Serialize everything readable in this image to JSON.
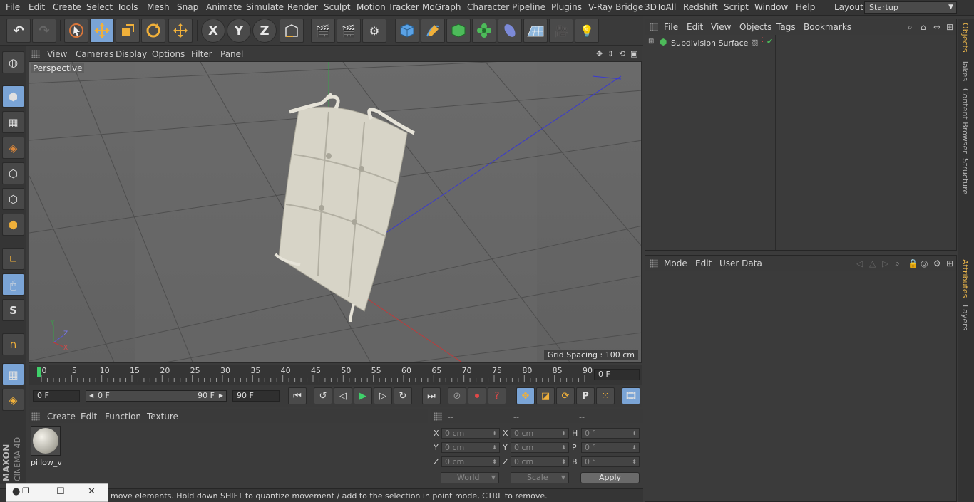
{
  "menubar": {
    "items": [
      "File",
      "Edit",
      "Create",
      "Select",
      "Tools",
      "Mesh",
      "Snap",
      "Animate",
      "Simulate",
      "Render",
      "Sculpt",
      "Motion Tracker",
      "MoGraph",
      "Character",
      "Pipeline",
      "Plugins",
      "V-Ray Bridge",
      "3DToAll",
      "Redshift",
      "Script",
      "Window",
      "Help"
    ],
    "layout_label": "Layout:",
    "layout_value": "Startup"
  },
  "toolbar": {
    "axis_x": "X",
    "axis_y": "Y",
    "axis_z": "Z"
  },
  "leftbar": {
    "snap_label": "S",
    "brand": "MAXON",
    "product": "CINEMA 4D"
  },
  "viewport": {
    "menu": [
      "View",
      "Cameras",
      "Display",
      "Options",
      "Filter",
      "Panel"
    ],
    "label": "Perspective",
    "grid_spacing": "Grid Spacing : 100 cm"
  },
  "timeline": {
    "ticks": [
      "0",
      "5",
      "10",
      "15",
      "20",
      "25",
      "30",
      "35",
      "40",
      "45",
      "50",
      "55",
      "60",
      "65",
      "70",
      "75",
      "80",
      "85",
      "90"
    ],
    "current_frame": "0 F"
  },
  "transport": {
    "start_field": "0 F",
    "range_start": "0 F",
    "range_end": "90 F",
    "end_field": "90 F",
    "param_label": "P"
  },
  "material": {
    "menu": [
      "Create",
      "Edit",
      "Function",
      "Texture"
    ],
    "name": "pillow_v"
  },
  "coordinates": {
    "headers": [
      "--",
      "--",
      "--"
    ],
    "rows": [
      {
        "l1": "X",
        "v1": "0 cm",
        "l2": "X",
        "v2": "0 cm",
        "l3": "H",
        "v3": "0 °"
      },
      {
        "l1": "Y",
        "v1": "0 cm",
        "l2": "Y",
        "v2": "0 cm",
        "l3": "P",
        "v3": "0 °"
      },
      {
        "l1": "Z",
        "v1": "0 cm",
        "l2": "Z",
        "v2": "0 cm",
        "l3": "B",
        "v3": "0 °"
      }
    ],
    "mode_world": "World",
    "mode_scale": "Scale",
    "apply": "Apply"
  },
  "statusbar": {
    "text": "move elements. Hold down SHIFT to quantize movement / add to the selection in point mode, CTRL to remove."
  },
  "objects": {
    "menu": [
      "File",
      "Edit",
      "View",
      "Objects",
      "Tags",
      "Bookmarks"
    ],
    "items": [
      {
        "name": "Subdivision Surface"
      }
    ]
  },
  "attributes": {
    "menu": [
      "Mode",
      "Edit",
      "User Data"
    ]
  },
  "right_tabs": [
    "Objects",
    "Takes",
    "Content Browser",
    "Structure",
    "Attributes",
    "Layers"
  ],
  "colors": {
    "accent": "#7aa4d6",
    "tab_active": "#e8b44a",
    "panel": "#3b3b3b"
  }
}
